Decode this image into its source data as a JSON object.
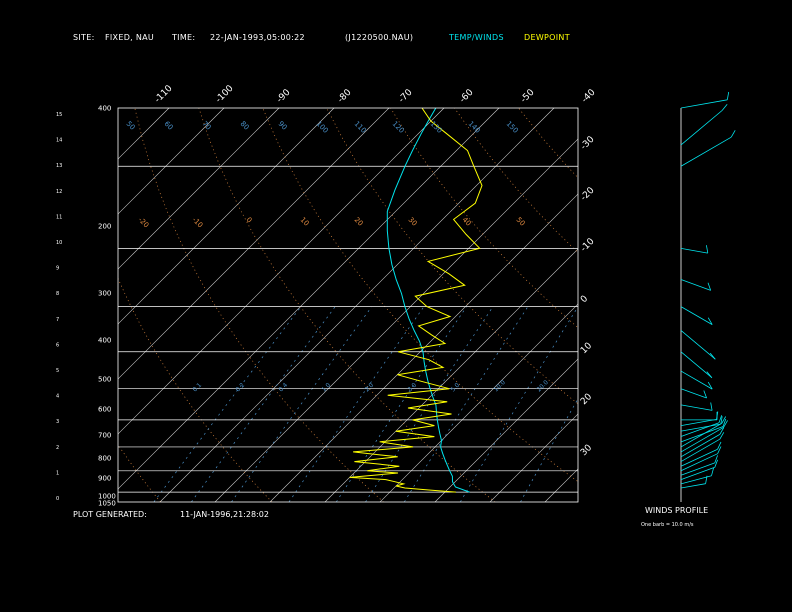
{
  "header": {
    "site_label": "SITE:",
    "site_value": "FIXED, NAU",
    "time_label": "TIME:",
    "time_value": "22-JAN-1993,05:00:22",
    "file_id": "(J1220500.NAU)",
    "temp_winds_label": "TEMP/WINDS",
    "dewpoint_label": "DEWPOINT"
  },
  "footer": {
    "generated_label": "PLOT GENERATED:",
    "generated_value": "11-JAN-1996,21:28:02",
    "winds_profile_label": "WINDS PROFILE",
    "barb_note": "One barb = 10.0 m/s"
  },
  "colors": {
    "background": "#000000",
    "text": "#ffffff",
    "temperature": "#00e5ee",
    "dewpoint": "#ffff00",
    "dry_adiabat": "#e08a40",
    "mixing_ratio": "#4a90c8",
    "frame": "#ffffff"
  },
  "chart_data": {
    "type": "skew-t",
    "pressure_ticks": [
      "400",
      "200",
      "300",
      "400",
      "500",
      "600",
      "700",
      "800",
      "900",
      "1000",
      "1050"
    ],
    "pressure_levels": [
      400,
      200,
      300,
      400,
      500,
      600,
      700,
      800,
      900,
      1000,
      1050
    ],
    "height_ticks_km": [
      "15",
      "14",
      "13",
      "12",
      "11",
      "10",
      "9",
      "8",
      "7",
      "6",
      "5",
      "4",
      "3",
      "2",
      "1",
      "0"
    ],
    "skew_temp_labels_top": [
      "-110",
      "-100",
      "-90",
      "-80",
      "-70",
      "-60",
      "-50",
      "-40"
    ],
    "skew_temp_labels_right": [
      "-30",
      "-20",
      "-10",
      "0",
      "10",
      "20",
      "30"
    ],
    "theta_labels": [
      "50",
      "60",
      "70",
      "80",
      "90",
      "100",
      "110",
      "120",
      "130",
      "140",
      "150"
    ],
    "dry_adiabat_labels": [
      "-20",
      "-10",
      "0",
      "10",
      "20",
      "30",
      "40",
      "50"
    ],
    "mixing_ratio_labels": [
      "0.1",
      "0.2",
      "0.4",
      "1.0",
      "2.0",
      "3.0",
      "5.0",
      "10.0",
      "20.0"
    ],
    "temperature": {
      "name": "TEMP/WINDS",
      "pressure": [
        1000,
        975,
        950,
        925,
        900,
        875,
        850,
        825,
        800,
        775,
        750,
        725,
        700,
        675,
        650,
        625,
        600,
        575,
        550,
        525,
        500,
        475,
        450,
        425,
        400,
        375,
        350,
        325,
        300,
        275,
        250,
        225,
        200,
        185,
        170,
        160,
        150
      ],
      "temp_c": [
        14.5,
        11.0,
        9.5,
        8.5,
        7.0,
        5.5,
        4.0,
        2.5,
        1.0,
        0.0,
        -1.5,
        -3.0,
        -4.5,
        -6.0,
        -7.5,
        -9.5,
        -11.5,
        -13.5,
        -15.5,
        -17.5,
        -19.5,
        -22.0,
        -25.0,
        -28.0,
        -31.0,
        -34.0,
        -37.5,
        -41.0,
        -44.5,
        -48.0,
        -51.5,
        -54.0,
        -56.5,
        -58.0,
        -59.5,
        -60.5,
        -61.5
      ]
    },
    "dewpoint": {
      "name": "DEWPOINT",
      "pressure": [
        1000,
        990,
        980,
        970,
        960,
        950,
        940,
        930,
        920,
        910,
        900,
        880,
        860,
        840,
        820,
        800,
        780,
        760,
        740,
        720,
        700,
        680,
        660,
        640,
        620,
        600,
        580,
        560,
        540,
        520,
        500,
        480,
        460,
        440,
        420,
        400,
        380,
        360,
        340,
        320,
        300,
        280,
        260,
        240,
        220,
        200,
        185,
        170,
        160,
        150
      ],
      "temp_c": [
        12.0,
        7.0,
        2.0,
        0.0,
        1.0,
        -1.0,
        -3.0,
        -10.0,
        -6.0,
        -2.0,
        -8.0,
        -3.0,
        -12.0,
        -5.0,
        -14.0,
        -4.0,
        -11.0,
        -2.0,
        -10.0,
        -4.0,
        -9.0,
        -3.0,
        -12.0,
        -6.0,
        -18.0,
        -8.0,
        -14.0,
        -20.0,
        -13.0,
        -17.0,
        -24.0,
        -17.0,
        -21.0,
        -25.0,
        -21.0,
        -27.0,
        -31.0,
        -24.0,
        -29.0,
        -35.0,
        -28.0,
        -33.0,
        -38.0,
        -37.0,
        -39.0,
        -44.0,
        -48.0,
        -55.0,
        -60.0,
        -64.0
      ]
    },
    "winds": {
      "pressure": [
        980,
        960,
        940,
        920,
        900,
        880,
        860,
        840,
        820,
        800,
        780,
        760,
        740,
        720,
        700,
        650,
        600,
        550,
        500,
        450,
        400,
        350,
        300,
        200,
        180,
        150
      ],
      "direction_deg": [
        280,
        285,
        290,
        290,
        295,
        295,
        300,
        300,
        300,
        300,
        290,
        290,
        280,
        280,
        270,
        260,
        250,
        240,
        230,
        230,
        240,
        250,
        260,
        300,
        310,
        280
      ],
      "speed_ms": [
        5,
        8,
        10,
        10,
        12,
        12,
        14,
        14,
        16,
        15,
        14,
        12,
        12,
        10,
        10,
        8,
        6,
        10,
        12,
        14,
        10,
        8,
        6,
        20,
        18,
        15
      ]
    }
  }
}
